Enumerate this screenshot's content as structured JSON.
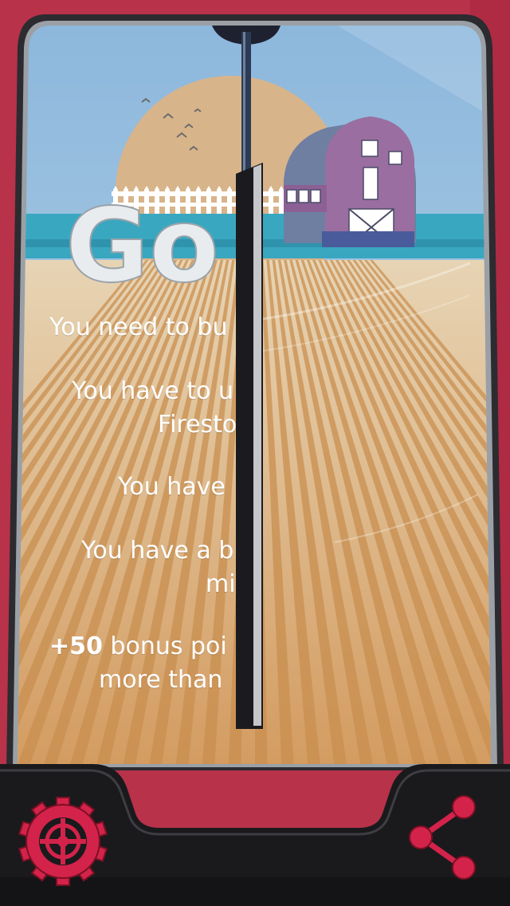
{
  "title_partial": "Go",
  "instructions": {
    "line1": "You need to bu",
    "line2a": "You have to u",
    "line2b": "Firesto",
    "line3": "You have",
    "line4a": "You have a b",
    "line4b": "mi",
    "line5_bold": "+50",
    "line5a_rest": " bonus poi",
    "line5b": "more than"
  },
  "icons": {
    "settings": "gear-crosshair-icon",
    "share": "share-icon"
  },
  "colors": {
    "frame": "#b8324a",
    "sky": "#a8c8df",
    "sun": "#d8b48a",
    "water": "#3aa7c0",
    "barn": "#9a6ea0",
    "accent_red": "#d3234a"
  }
}
